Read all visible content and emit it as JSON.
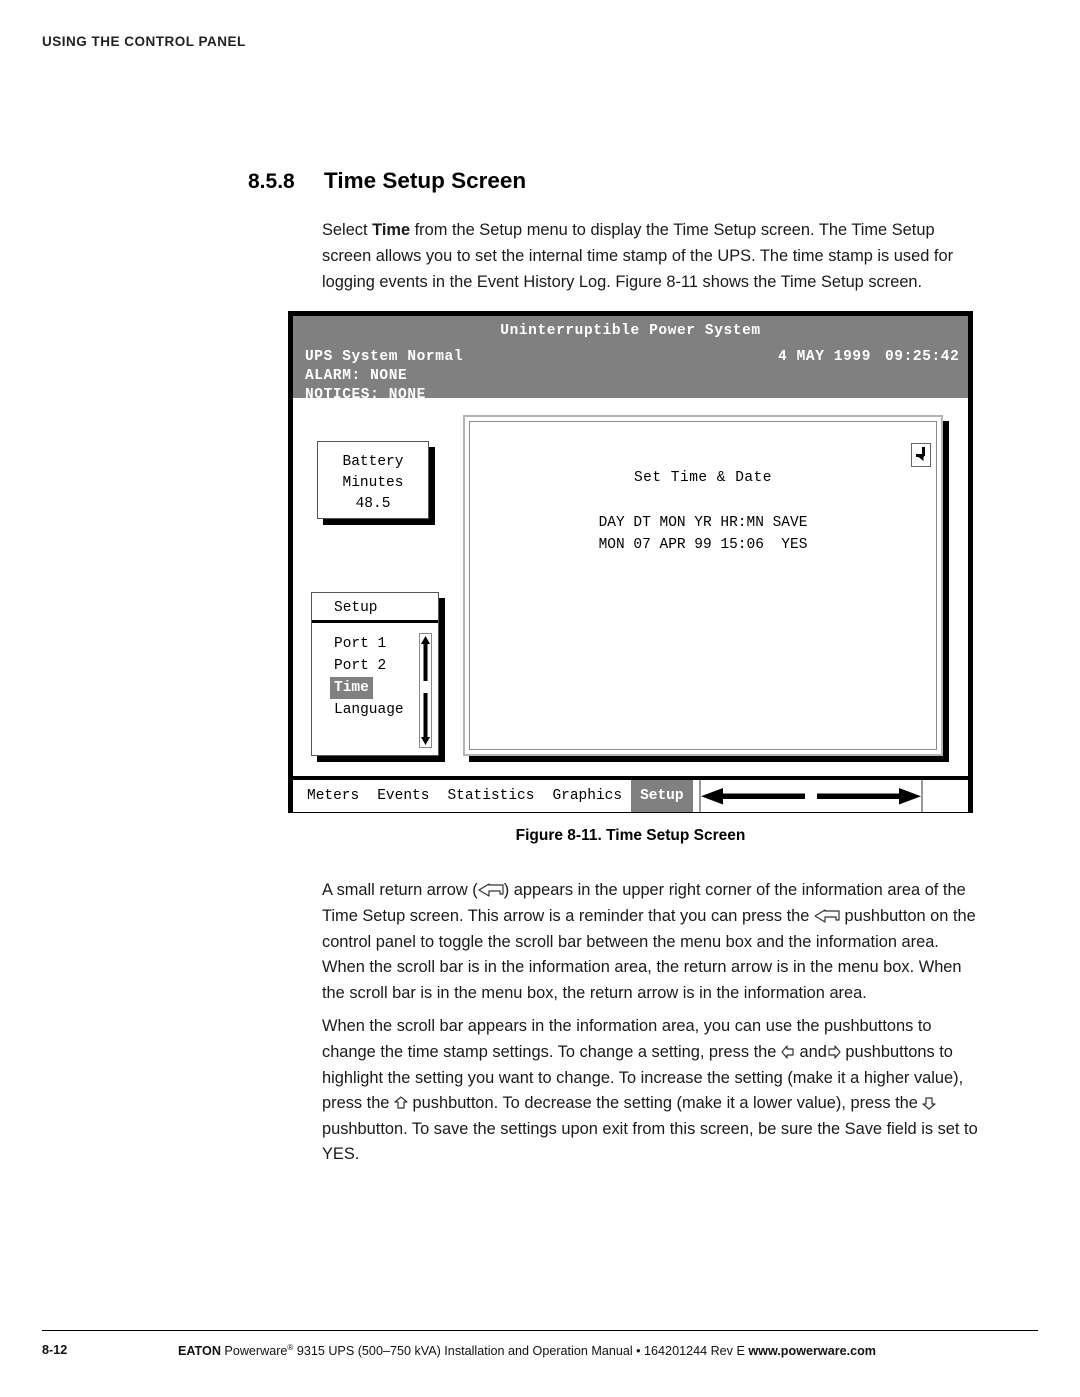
{
  "running_head": "USING THE CONTROL PANEL",
  "section": {
    "number": "8.5.8",
    "title": "Time Setup Screen"
  },
  "paragraphs": {
    "intro_a": "Select ",
    "intro_b": "Time",
    "intro_c": " from the Setup menu to display the Time Setup screen. The Time Setup screen allows you to set the internal time stamp of the UPS. The time stamp is used for logging events in the Event History Log. Figure 8-11 shows the Time Setup screen.",
    "p1_a": "A small return arrow (",
    "p1_b": ") appears in the upper right corner of the information area of the Time Setup screen. This arrow is a reminder that you can press the ",
    "p1_c": " pushbutton on the control panel to toggle the scroll bar between the menu box and the information area. When the scroll bar is in the information area, the return arrow is in the menu box. When the scroll bar is in the menu box, the return arrow is in the information area.",
    "p2_a": "When the scroll bar appears in the information area, you can use the pushbuttons to change the time stamp settings. To change a setting, press the ",
    "p2_b": " and",
    "p2_c": " pushbuttons to highlight the setting you want to change. To increase the setting (make it a higher value), press the ",
    "p2_d": " pushbutton. To decrease the setting (make it a lower value), press the ",
    "p2_e": " pushbutton. To save the settings upon exit from this screen, be sure the Save field is set to YES."
  },
  "figure": {
    "caption": "Figure 8-11. Time Setup Screen",
    "status": {
      "title": "Uninterruptible Power System",
      "line1": "UPS System Normal",
      "line2": "ALARM:  NONE",
      "line3": "NOTICES: NONE",
      "date": "4 MAY 1999",
      "time": "09:25:42"
    },
    "battery": {
      "line1": "Battery",
      "line2": "Minutes",
      "value": "48.5"
    },
    "menu": {
      "title": "Setup",
      "items": [
        {
          "label": "Port 1",
          "selected": false
        },
        {
          "label": "Port 2",
          "selected": false
        },
        {
          "label": "Time",
          "selected": true
        },
        {
          "label": "Language",
          "selected": false
        }
      ]
    },
    "info": {
      "title": "Set Time & Date",
      "header_row": "DAY DT MON YR HR:MN SAVE",
      "value_row": "MON 07 APR 99 15:06  YES"
    },
    "tabs": [
      {
        "label": "Meters",
        "selected": false
      },
      {
        "label": "Events",
        "selected": false
      },
      {
        "label": "Statistics",
        "selected": false
      },
      {
        "label": "Graphics",
        "selected": false
      },
      {
        "label": "Setup",
        "selected": true
      }
    ]
  },
  "footer": {
    "page": "8-12",
    "brand": "EATON",
    "text_a": " Powerware",
    "reg": "®",
    "text_b": " 9315 UPS (500–750 kVA) Installation and Operation Manual  •  164201244 Rev E ",
    "url": "www.powerware.com"
  },
  "colors": {
    "status_gray": "#808080",
    "highlight_gray": "#808080",
    "page_bg": "#ffffff",
    "ink": "#000000"
  }
}
